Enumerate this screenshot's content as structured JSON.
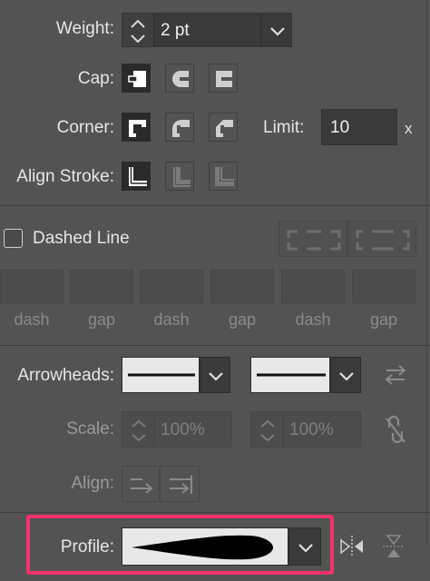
{
  "stroke": {
    "weight": {
      "label": "Weight:",
      "value": "2 pt"
    },
    "cap": {
      "label": "Cap:"
    },
    "corner": {
      "label": "Corner:",
      "limit_label": "Limit:",
      "limit_value": "10",
      "limit_suffix": "x"
    },
    "align": {
      "label": "Align Stroke:"
    }
  },
  "dashed": {
    "label": "Dashed Line",
    "checked": false,
    "fields": [
      "dash",
      "gap",
      "dash",
      "gap",
      "dash",
      "gap"
    ]
  },
  "arrowheads": {
    "label": "Arrowheads:",
    "scale_label": "Scale:",
    "scale_start": "100%",
    "scale_end": "100%",
    "align_label": "Align:"
  },
  "profile": {
    "label": "Profile:",
    "highlight_color": "#f2336b"
  },
  "icons": [
    "stepper-icon",
    "chevron-down-icon",
    "butt-cap-icon",
    "round-cap-icon",
    "projecting-cap-icon",
    "miter-join-icon",
    "round-join-icon",
    "bevel-join-icon",
    "align-center-icon",
    "align-inside-icon",
    "align-outside-icon",
    "dash-corners-icon",
    "dash-adjust-icon",
    "swap-arrows-icon",
    "link-scale-icon",
    "arrow-tip-extend-icon",
    "arrow-tip-place-icon",
    "flip-horizontal-icon",
    "flip-vertical-icon"
  ]
}
